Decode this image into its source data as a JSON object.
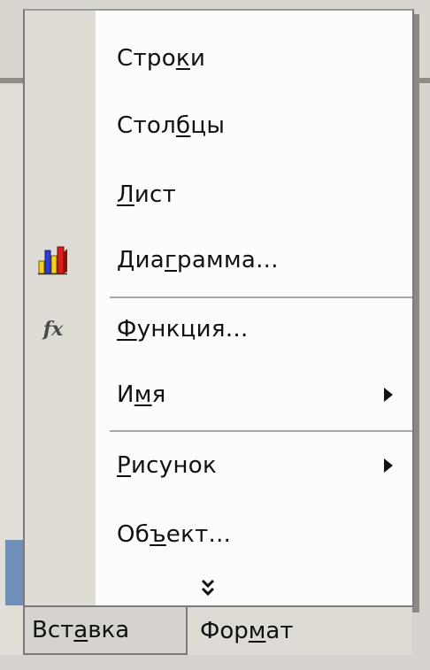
{
  "menu": {
    "items": [
      {
        "pre": "Стро",
        "u": "к",
        "post": "и",
        "icon": "",
        "submenu": false
      },
      {
        "pre": "Стол",
        "u": "б",
        "post": "цы",
        "icon": "",
        "submenu": false
      },
      {
        "pre": "",
        "u": "Л",
        "post": "ист",
        "icon": "",
        "submenu": false
      },
      {
        "pre": "Диа",
        "u": "г",
        "post": "рамма...",
        "icon": "chart-icon",
        "submenu": false
      },
      {
        "pre": "",
        "u": "Ф",
        "post": "ункция...",
        "icon": "function-icon",
        "submenu": false
      },
      {
        "pre": "И",
        "u": "м",
        "post": "я",
        "icon": "",
        "submenu": true
      },
      {
        "pre": "",
        "u": "Р",
        "post": "исунок",
        "icon": "",
        "submenu": true
      },
      {
        "pre": "Об",
        "u": "ъ",
        "post": "ект...",
        "icon": "",
        "submenu": false
      }
    ],
    "expand_glyph": "⮋",
    "function_icon_text": "fx"
  },
  "menubar": {
    "insert": {
      "pre": "Вст",
      "u": "а",
      "post": "вка"
    },
    "format": {
      "pre": "Фор",
      "u": "м",
      "post": "ат"
    }
  },
  "colors": {
    "chart_red": "#d91e1e",
    "chart_yellow": "#f2d21b",
    "chart_blue": "#2b3fd6"
  }
}
